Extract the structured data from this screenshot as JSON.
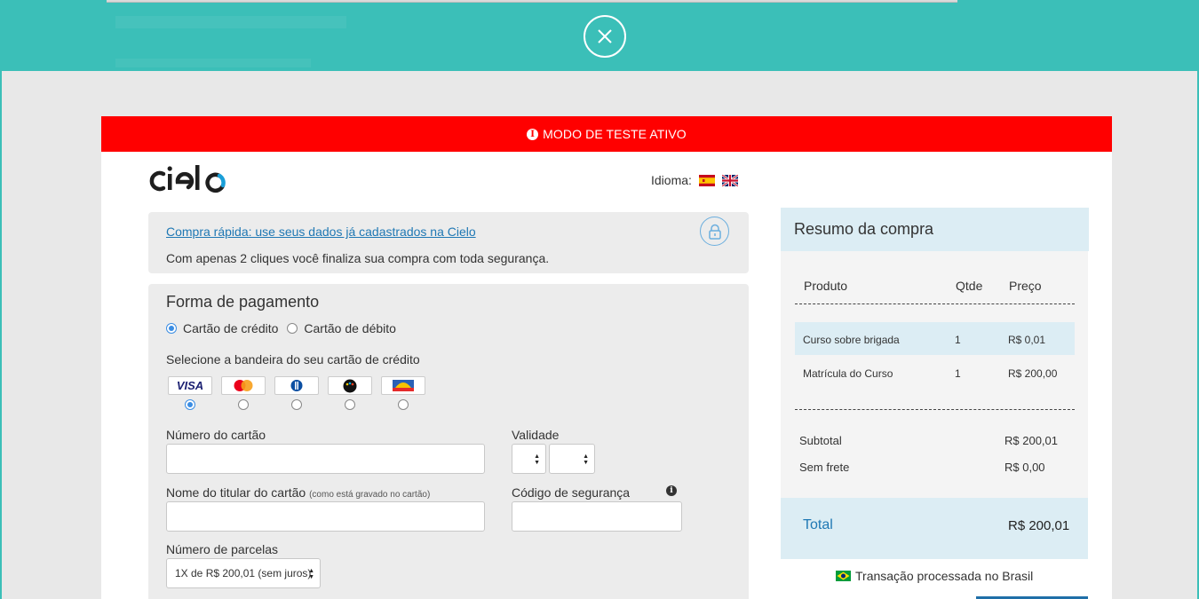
{
  "banner": {
    "text": "MODO DE TESTE ATIVO"
  },
  "language": {
    "label": "Idioma:"
  },
  "quick_buy": {
    "link": "Compra rápida: use seus dados já cadastrados na Cielo",
    "description": "Com apenas 2 cliques você finaliza sua compra com toda segurança."
  },
  "payment": {
    "title": "Forma de pagamento",
    "options": [
      {
        "label": "Cartão de crédito",
        "selected": true
      },
      {
        "label": "Cartão de débito",
        "selected": false
      }
    ],
    "brand_label": "Selecione a bandeira do seu cartão de crédito",
    "brands": [
      {
        "name": "Visa",
        "text": "VISA",
        "selected": true
      },
      {
        "name": "MasterCard",
        "selected": false
      },
      {
        "name": "Diners",
        "selected": false
      },
      {
        "name": "Elo",
        "selected": false
      },
      {
        "name": "Aura",
        "selected": false
      }
    ],
    "card_number_label": "Número do cartão",
    "card_number_value": "",
    "validity_label": "Validade",
    "holder_label": "Nome do titular do cartão",
    "holder_hint": "(como está gravado no cartão)",
    "holder_value": "",
    "cvv_label": "Código de segurança",
    "cvv_value": "",
    "installments_label": "Número de parcelas",
    "installments_value": "1X de R$ 200,01 (sem juros)"
  },
  "summary": {
    "title": "Resumo da compra",
    "columns": [
      "Produto",
      "Qtde",
      "Preço"
    ],
    "items": [
      {
        "product": "Curso sobre brigada",
        "qty": "1",
        "price": "R$ 0,01"
      },
      {
        "product": "Matrícula do Curso",
        "qty": "1",
        "price": "R$ 200,00"
      }
    ],
    "subtotal_label": "Subtotal",
    "subtotal_value": "R$ 200,01",
    "shipping_label": "Sem frete",
    "shipping_value": "R$ 0,00",
    "total_label": "Total",
    "total_value": "R$ 200,01"
  },
  "footer": {
    "note": "Transação processada no Brasil"
  },
  "colors": {
    "topbar": "#3bbfb8",
    "banner": "#ff0000",
    "accent_blue": "#1f78b4",
    "summary_highlight": "#dcedf4"
  },
  "icons": [
    "close-icon",
    "info-icon",
    "lock-icon",
    "spain-flag-icon",
    "uk-flag-icon",
    "brazil-flag-icon",
    "cielo-logo"
  ]
}
